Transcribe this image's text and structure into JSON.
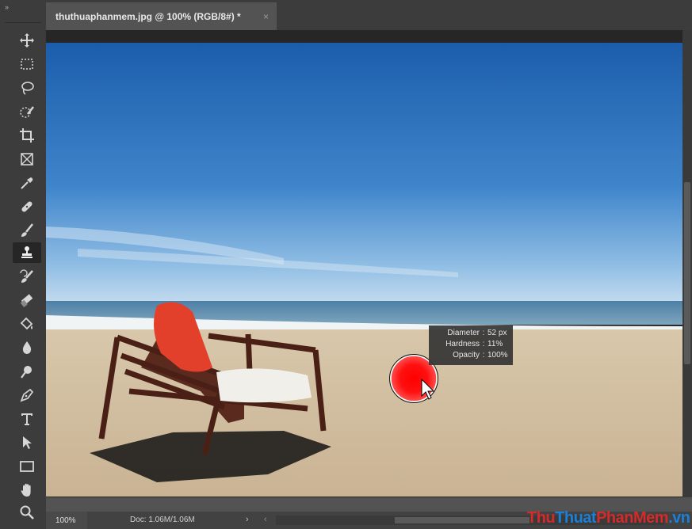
{
  "document": {
    "tab_title": "thuthuaphanmem.jpg @ 100% (RGB/8#) *",
    "close_glyph": "×"
  },
  "toolbar": {
    "grip": "››",
    "active_tool": "clone-stamp",
    "tools": [
      "move-tool-icon",
      "marquee-tool-icon",
      "lasso-tool-icon",
      "quick-select-tool-icon",
      "crop-tool-icon",
      "frame-tool-icon",
      "eyedropper-tool-icon",
      "healing-brush-icon",
      "brush-tool-icon",
      "clone-stamp-icon",
      "history-brush-icon",
      "eraser-tool-icon",
      "paint-bucket-icon",
      "blur-tool-icon",
      "dodge-tool-icon",
      "pen-tool-icon",
      "type-tool-icon",
      "path-selection-icon",
      "rectangle-tool-icon",
      "hand-tool-icon",
      "zoom-tool-icon"
    ]
  },
  "brush_hud": {
    "diameter_label": "Diameter",
    "diameter_value": "52 px",
    "hardness_label": "Hardness",
    "hardness_value": "11%",
    "opacity_label": "Opacity",
    "opacity_value": "100%"
  },
  "status": {
    "zoom": "100%",
    "doc_info": "Doc: 1.06M/1.06M",
    "arrow": "›",
    "scroll_left": "‹"
  },
  "watermark": {
    "part1": "Thu",
    "part2": "Thuat",
    "part3": "PhanMem",
    "part4": ".vn",
    "color_a": "#d42a2a",
    "color_b": "#1b7fd6"
  }
}
